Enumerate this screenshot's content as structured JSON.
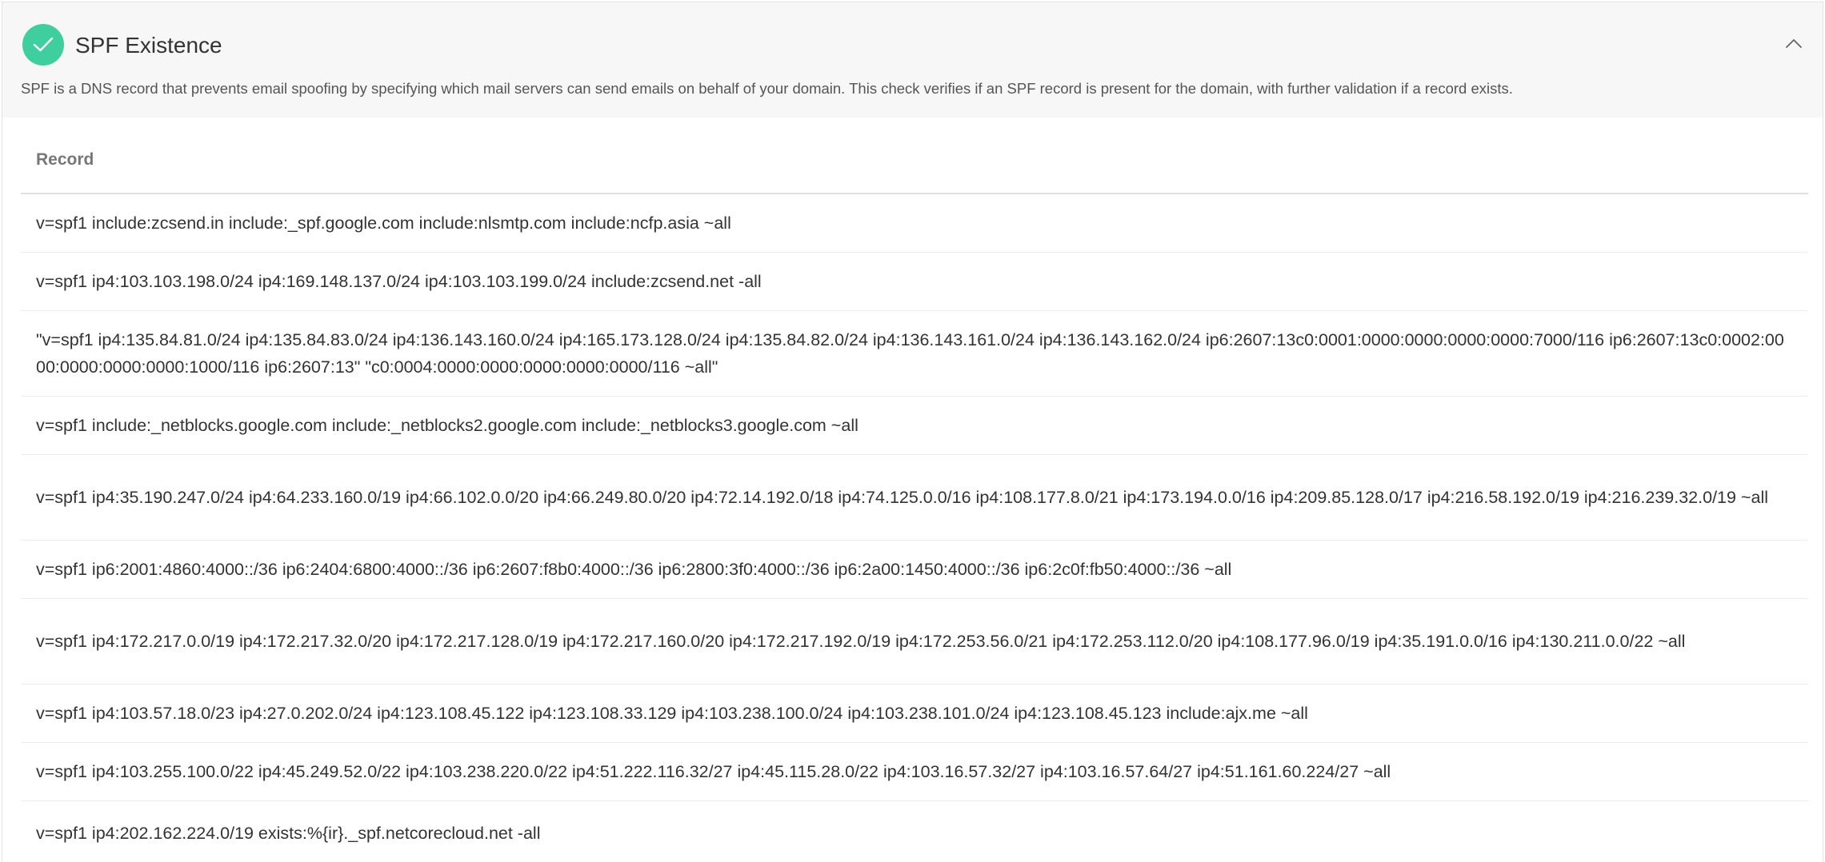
{
  "check": {
    "title": "SPF Existence",
    "status": "passed",
    "status_color": "#3fcf9f",
    "status_icon": "checkmark-icon",
    "collapse_icon": "chevron-up-icon",
    "description": "SPF is a DNS record that prevents email spoofing by specifying which mail servers can send emails on behalf of your domain. This check verifies if an SPF record is present for the domain, with further validation if a record exists."
  },
  "table": {
    "column_header": "Record",
    "rows": [
      "v=spf1 include:zcsend.in include:_spf.google.com include:nlsmtp.com include:ncfp.asia ~all",
      "v=spf1 ip4:103.103.198.0/24 ip4:169.148.137.0/24 ip4:103.103.199.0/24 include:zcsend.net -all",
      "\"v=spf1 ip4:135.84.81.0/24 ip4:135.84.83.0/24 ip4:136.143.160.0/24 ip4:165.173.128.0/24 ip4:135.84.82.0/24 ip4:136.143.161.0/24 ip4:136.143.162.0/24 ip6:2607:13c0:0001:0000:0000:0000:0000:7000/116 ip6:2607:13c0:0002:0000:0000:0000:0000:1000/116 ip6:2607:13\" \"c0:0004:0000:0000:0000:0000:0000/116 ~all\"",
      "v=spf1 include:_netblocks.google.com include:_netblocks2.google.com include:_netblocks3.google.com ~all",
      "v=spf1 ip4:35.190.247.0/24 ip4:64.233.160.0/19 ip4:66.102.0.0/20 ip4:66.249.80.0/20 ip4:72.14.192.0/18 ip4:74.125.0.0/16 ip4:108.177.8.0/21 ip4:173.194.0.0/16 ip4:209.85.128.0/17 ip4:216.58.192.0/19 ip4:216.239.32.0/19 ~all",
      "v=spf1 ip6:2001:4860:4000::/36 ip6:2404:6800:4000::/36 ip6:2607:f8b0:4000::/36 ip6:2800:3f0:4000::/36 ip6:2a00:1450:4000::/36 ip6:2c0f:fb50:4000::/36 ~all",
      "v=spf1 ip4:172.217.0.0/19 ip4:172.217.32.0/20 ip4:172.217.128.0/19 ip4:172.217.160.0/20 ip4:172.217.192.0/19 ip4:172.253.56.0/21 ip4:172.253.112.0/20 ip4:108.177.96.0/19 ip4:35.191.0.0/16 ip4:130.211.0.0/22 ~all",
      "v=spf1 ip4:103.57.18.0/23 ip4:27.0.202.0/24 ip4:123.108.45.122 ip4:123.108.33.129 ip4:103.238.100.0/24 ip4:103.238.101.0/24 ip4:123.108.45.123 include:ajx.me ~all",
      "v=spf1 ip4:103.255.100.0/22 ip4:45.249.52.0/22 ip4:103.238.220.0/22 ip4:51.222.116.32/27 ip4:45.115.28.0/22 ip4:103.16.57.32/27 ip4:103.16.57.64/27 ip4:51.161.60.224/27 ~all",
      "v=spf1 ip4:202.162.224.0/19 exists:%{ir}._spf.netcorecloud.net -all"
    ]
  }
}
